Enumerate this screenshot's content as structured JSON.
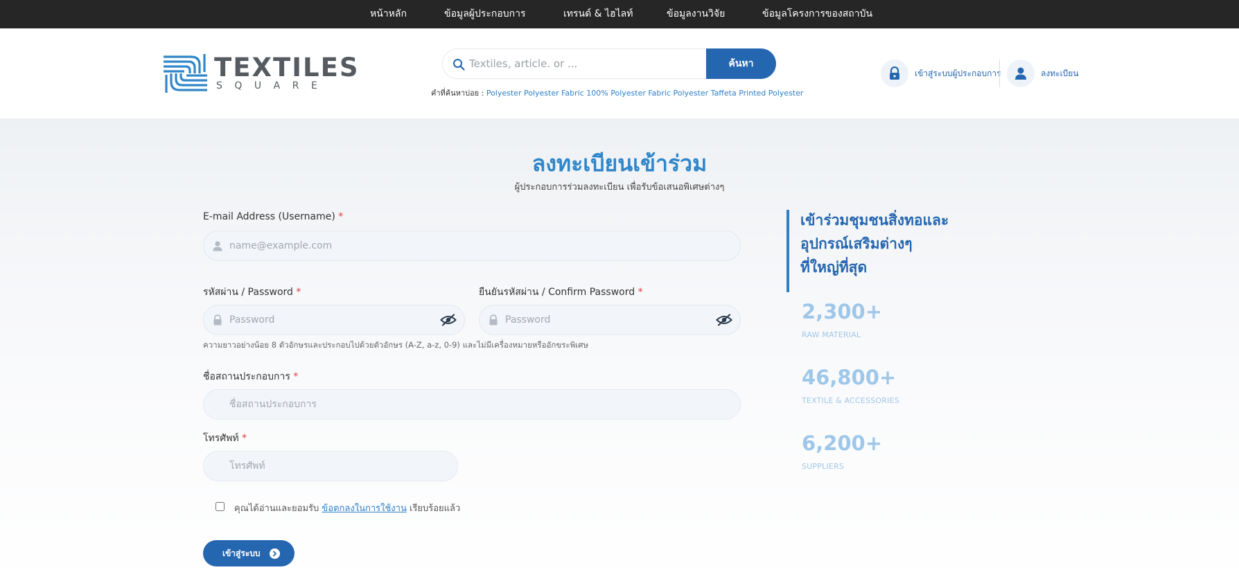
{
  "topnav": {
    "items": [
      {
        "label": "หน้าหลัก"
      },
      {
        "label": "ข้อมูลผู้ประกอบการ"
      },
      {
        "label": "เทรนด์ & ไฮไลท์"
      },
      {
        "label": "ข้อมูลงานวิจัย"
      },
      {
        "label": "ข้อมูลโครงการของสถาบัน"
      }
    ]
  },
  "header": {
    "logo": {
      "word": "TEXTILES",
      "sub": "SQUARE",
      "icon": "textiles-square-logo-icon"
    },
    "search": {
      "placeholder": "Textiles, article. or ...",
      "button_label": "ค้นหา",
      "icon": "search-icon"
    },
    "popular": {
      "label": "คำที่ค้นหาบ่อย : ",
      "links": [
        "Polyester",
        "Polyester Fabric",
        "100% Polyester Fabric",
        "Polyester Taffeta",
        "Printed Polyester"
      ]
    },
    "login": {
      "label": "เข้าสู่ระบบผู้ประกอบการ",
      "icon": "lock-icon"
    },
    "register": {
      "label": "ลงทะเบียน",
      "icon": "user-icon"
    }
  },
  "form": {
    "title": "ลงทะเบียนเข้าร่วม",
    "subtitle": "ผู้ประกอบการร่วมลงทะเบียน เพื่อรับข้อเสนอพิเศษต่างๆ",
    "required_mark": "*",
    "email": {
      "label": "E-mail Address (Username) ",
      "placeholder": "name@example.com",
      "icon": "user-icon"
    },
    "password": {
      "label": "รหัสผ่าน / Password ",
      "placeholder": "Password",
      "icon": "lock-icon",
      "toggle_icon": "eye-slash-icon"
    },
    "confirm": {
      "label": "ยืนยันรหัสผ่าน / Confirm Password ",
      "placeholder": "Password",
      "icon": "lock-icon",
      "toggle_icon": "eye-slash-icon"
    },
    "password_hint": "ความยาวอย่างน้อย 8 ตัวอักษรและประกอบไปด้วยตัวอักษร (A-Z, a-z, 0-9) และไม่มีเครื่องหมายหรืออักขระพิเศษ",
    "company": {
      "label": "ชื่อสถานประกอบการ ",
      "placeholder": "ชื่อสถานประกอบการ"
    },
    "phone": {
      "label": "โทรศัพท์ ",
      "placeholder": "โทรศัพท์"
    },
    "agree": {
      "prefix": "คุณได้อ่านและยอมรับ ",
      "link": "ข้อตกลงในการใช้งาน",
      "suffix": " เรียบร้อยแล้ว",
      "checked": false
    },
    "submit": {
      "label": "เข้าสู่ระบบ",
      "icon": "chevron-right-circle-icon"
    }
  },
  "side": {
    "title_lines": [
      "เข้าร่วมชุมชนสิ่งทอและ",
      "อุปกรณ์เสริมต่างๆ",
      "ที่ใหญ่ที่สุด"
    ],
    "stats": [
      {
        "value": "2,300+",
        "label": "RAW MATERIAL"
      },
      {
        "value": "46,800+",
        "label": "TEXTILE & ACCESSORIES"
      },
      {
        "value": "6,200+",
        "label": "SUPPLIERS"
      }
    ]
  },
  "colors": {
    "primary": "#2566b0",
    "accent": "#2f86c9",
    "nav_bg": "#262626",
    "required": "#e0393e",
    "stat": "#9fc7e9"
  }
}
